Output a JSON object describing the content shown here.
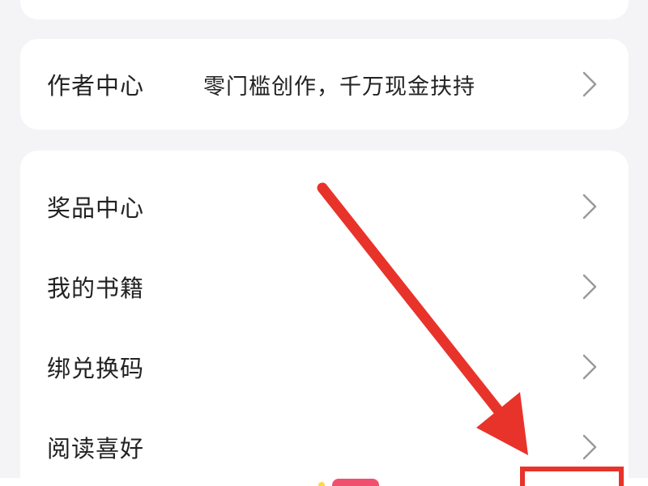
{
  "author_center": {
    "label": "作者中心",
    "description": "零门槛创作，千万现金扶持"
  },
  "menu": {
    "items": [
      {
        "label": "奖品中心"
      },
      {
        "label": "我的书籍"
      },
      {
        "label": "绑兑换码"
      },
      {
        "label": "阅读喜好"
      }
    ]
  },
  "colors": {
    "background": "#f4f4f6",
    "card": "#ffffff",
    "text": "#222222",
    "chevron": "#9a9a9a",
    "annotation_arrow": "#e8332b",
    "badge": "#f0506e"
  }
}
